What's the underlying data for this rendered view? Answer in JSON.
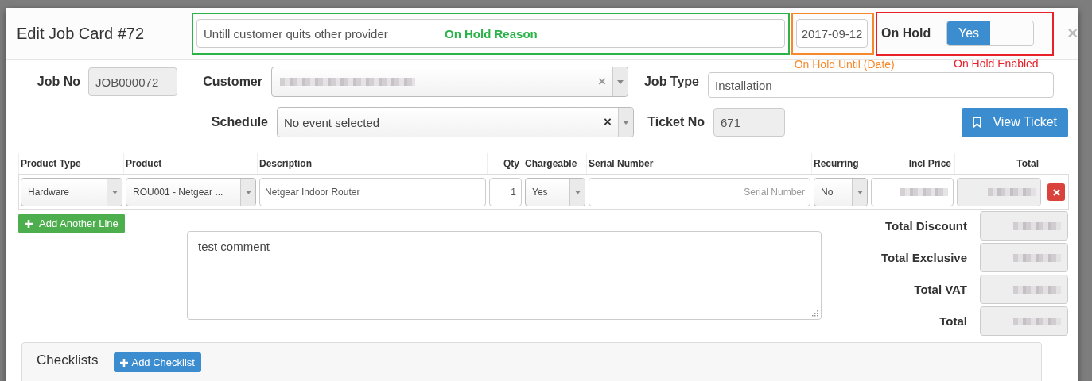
{
  "modal": {
    "title": "Edit Job Card #72",
    "close": "×"
  },
  "on_hold": {
    "reason": "Untill customer quits other provider",
    "until": "2017-09-12",
    "label": "On Hold",
    "toggle": {
      "label": "Yes",
      "on": true
    }
  },
  "annotations": [
    {
      "text": "On Hold Reason",
      "color": "#2bb34a",
      "kind": "inside"
    },
    {
      "text": "On Hold Until (Date)",
      "color": "#f7892b",
      "kind": "below"
    },
    {
      "text": "On Hold Enabled",
      "color": "#e8202a",
      "kind": "below"
    }
  ],
  "job": {
    "job_no_label": "Job No",
    "job_no": "JOB000072",
    "customer_label": "Customer",
    "customer_clear": "×",
    "job_type_label": "Job Type",
    "job_type": "Installation",
    "schedule_label": "Schedule",
    "schedule": "No event selected",
    "schedule_clear": "×",
    "ticket_no_label": "Ticket No",
    "ticket_no": "671",
    "view_ticket": "View Ticket"
  },
  "lines": {
    "columns": [
      "Product Type",
      "Product",
      "Description",
      "Qty",
      "Chargeable",
      "Serial Number",
      "Recurring",
      "Incl Price",
      "Total"
    ],
    "rows": [
      {
        "product_type": "Hardware",
        "product": "ROU001 - Netgear ...",
        "description": "Netgear Indoor Router",
        "qty": "1",
        "chargeable": "Yes",
        "serial_placeholder": "Serial Number",
        "recurring": "No"
      }
    ]
  },
  "add_line": "Add Another Line",
  "comment": "test comment",
  "totals": [
    "Total Discount",
    "Total Exclusive",
    "Total VAT",
    "Total"
  ],
  "checklists": {
    "title": "Checklists",
    "add": "Add Checklist"
  }
}
